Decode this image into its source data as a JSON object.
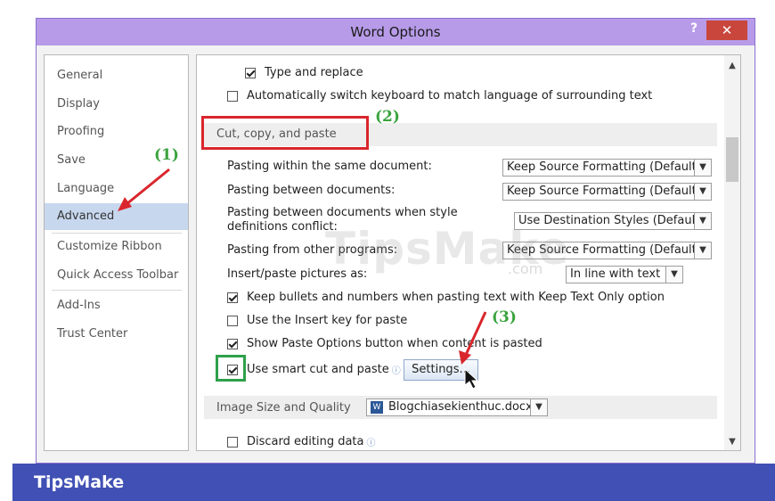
{
  "window": {
    "title": "Word Options",
    "help": "?",
    "close": "✕"
  },
  "sidebar": {
    "items": [
      {
        "label": "General"
      },
      {
        "label": "Display"
      },
      {
        "label": "Proofing"
      },
      {
        "label": "Save"
      },
      {
        "label": "Language"
      },
      {
        "label": "Advanced",
        "active": true
      },
      {
        "label": "Customize Ribbon"
      },
      {
        "label": "Quick Access Toolbar"
      },
      {
        "label": "Add-Ins"
      },
      {
        "label": "Trust Center"
      }
    ]
  },
  "editing": {
    "type_and_replace": "Type and replace",
    "auto_keyboard": "Automatically switch keyboard to match language of surrounding text"
  },
  "cut_copy_paste": {
    "heading": "Cut, copy, and paste",
    "within_doc_label": "Pasting within the same document:",
    "within_doc_value": "Keep Source Formatting (Default)",
    "between_docs_label": "Pasting between documents:",
    "between_docs_value": "Keep Source Formatting (Default)",
    "conflict_label_1": "Pasting between documents when style",
    "conflict_label_2": "definitions conflict:",
    "conflict_value": "Use Destination Styles (Default)",
    "other_programs_label": "Pasting from other programs:",
    "other_programs_value": "Keep Source Formatting (Default)",
    "pictures_label": "Insert/paste pictures as:",
    "pictures_value": "In line with text",
    "keep_bullets": "Keep bullets and numbers when pasting text with Keep Text Only option",
    "insert_key": "Use the Insert key for paste",
    "show_paste_options": "Show Paste Options button when content is pasted",
    "smart_cut": "Use smart cut and paste",
    "settings_button": "Settings..."
  },
  "image_quality": {
    "heading": "Image Size and Quality",
    "document": "Blogchiasekienthuc.docx",
    "discard_editing": "Discard editing data"
  },
  "annotations": {
    "step1": "(1)",
    "step2": "(2)",
    "step3": "(3)"
  },
  "watermark": {
    "text": "TipsMake",
    "suffix": ".com"
  },
  "brand": {
    "name": "TipsMake"
  },
  "colors": {
    "titlebar": "#b79be8",
    "close_button": "#c9463d",
    "annotation_red": "#d9262c",
    "annotation_green": "#3aa33e",
    "active_nav": "#c7d7ee",
    "banner": "#4050b4"
  }
}
